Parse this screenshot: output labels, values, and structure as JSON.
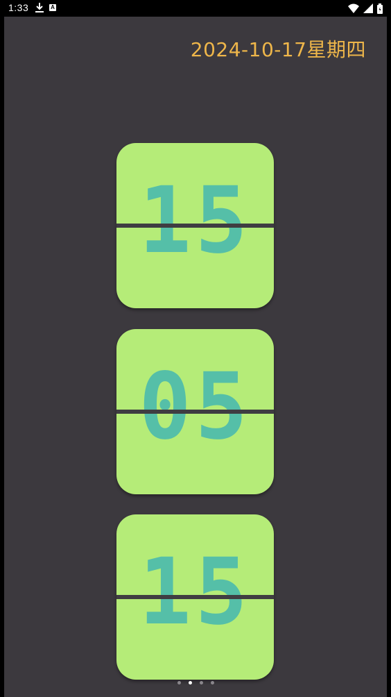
{
  "status_bar": {
    "time": "1:33",
    "icons": [
      "download-icon",
      "font-a-icon",
      "wifi-icon",
      "signal-icon",
      "battery-icon"
    ],
    "notification_letter": "A"
  },
  "header": {
    "date_text": "2024-10-17星期四"
  },
  "clock": {
    "hours": "15",
    "minutes": "05",
    "seconds": "15"
  },
  "pager": {
    "page_count": 4,
    "active_index": 1
  },
  "colors": {
    "background": "#3c393e",
    "card": "#b5ec78",
    "digits": "#55bfa8",
    "date_text": "#eeb64a",
    "divider": "#3f3d42"
  }
}
